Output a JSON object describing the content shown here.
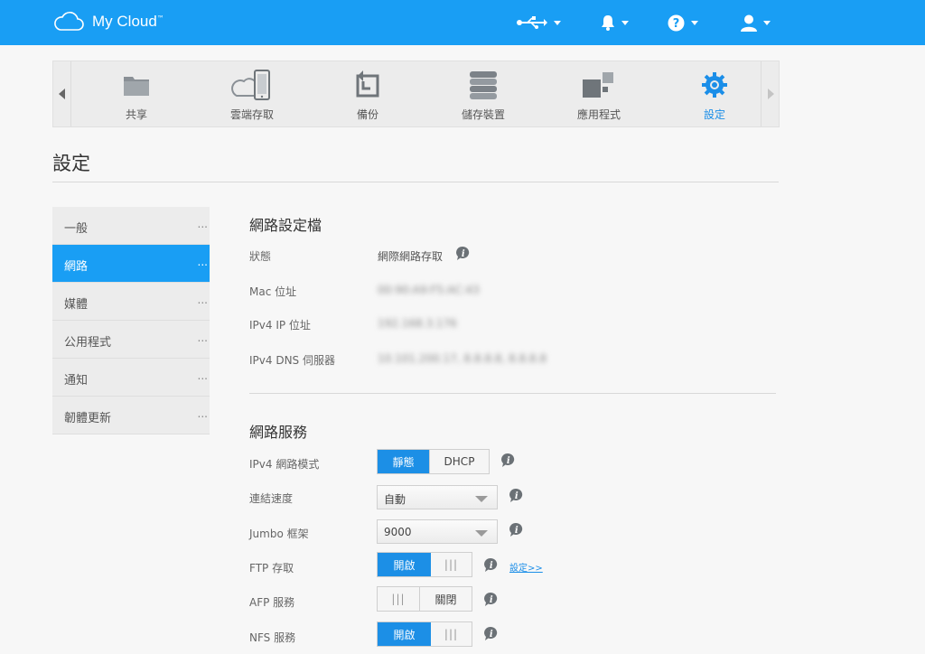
{
  "app": {
    "title": "My Cloud",
    "tm": "™"
  },
  "nav": {
    "items": [
      {
        "label": "共享",
        "icon": "folder-icon"
      },
      {
        "label": "雲端存取",
        "icon": "cloud-phone-icon"
      },
      {
        "label": "備份",
        "icon": "backup-icon"
      },
      {
        "label": "儲存裝置",
        "icon": "storage-icon"
      },
      {
        "label": "應用程式",
        "icon": "apps-icon"
      },
      {
        "label": "設定",
        "icon": "gear-icon"
      }
    ],
    "active": "設定"
  },
  "page": {
    "title": "設定"
  },
  "sidebar": {
    "items": [
      {
        "label": "一般",
        "more": "..."
      },
      {
        "label": "網路",
        "more": "..."
      },
      {
        "label": "媒體",
        "more": "..."
      },
      {
        "label": "公用程式",
        "more": "..."
      },
      {
        "label": "通知",
        "more": "..."
      },
      {
        "label": "韌體更新",
        "more": "..."
      }
    ],
    "active": "網路"
  },
  "profile": {
    "title": "網路設定檔",
    "rows": [
      {
        "label": "狀態",
        "value": "網際網路存取"
      },
      {
        "label": "Mac 位址",
        "value": "00:90:A9:F5:AC:43"
      },
      {
        "label": "IPv4 IP 位址",
        "value": "192.168.3.176"
      },
      {
        "label": "IPv4 DNS 伺服器",
        "value": "10.101.200.17, 8.8.8.8, 8.8.8.8"
      }
    ]
  },
  "services": {
    "title": "網路服務",
    "ipv4_mode": {
      "label": "IPv4 網路模式",
      "opt_static": "靜態",
      "opt_dhcp": "DHCP",
      "selected": "靜態"
    },
    "link_speed": {
      "label": "連結速度",
      "value": "自動"
    },
    "jumbo": {
      "label": "Jumbo 框架",
      "value": "9000"
    },
    "ftp": {
      "label": "FTP 存取",
      "state": "開啟",
      "grip": "|||",
      "settings_link": "設定>>"
    },
    "afp": {
      "label": "AFP 服務",
      "state": "關閉",
      "grip": "|||"
    },
    "nfs": {
      "label": "NFS 服務",
      "state": "開啟",
      "grip": "|||"
    }
  },
  "colors": {
    "brand": "#199ef4",
    "toggle_on": "#1c8fe6"
  }
}
